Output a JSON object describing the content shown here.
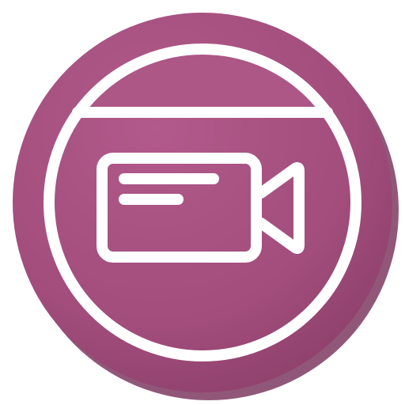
{
  "app_icon": {
    "icon": "video-camera-icon",
    "colors": {
      "background": "#ffffff",
      "badge": "#a24d7c",
      "badge_shadow": "#7e3a61",
      "line": "#ffffff"
    }
  }
}
